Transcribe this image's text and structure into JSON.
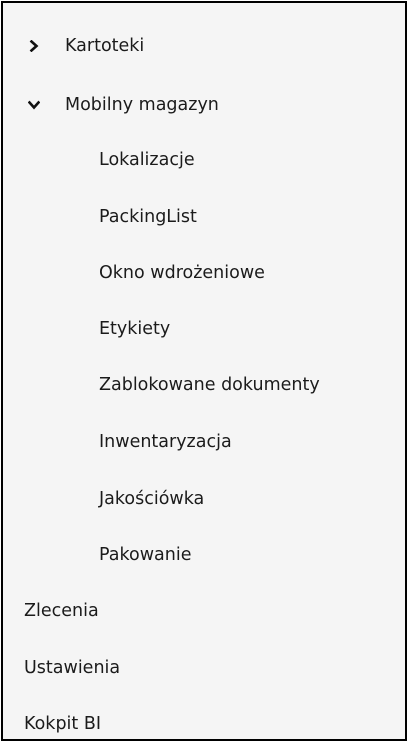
{
  "menu": {
    "kartoteki": {
      "label": "Kartoteki",
      "icon": "chevron-right-icon"
    },
    "mobilny_magazyn": {
      "label": "Mobilny magazyn",
      "icon": "chevron-down-icon",
      "children": [
        "Lokalizacje",
        "PackingList",
        "Okno wdrożeniowe",
        "Etykiety",
        "Zablokowane dokumenty",
        "Inwentaryzacja",
        "Jakościówka",
        "Pakowanie"
      ]
    },
    "zlecenia": {
      "label": "Zlecenia"
    },
    "ustawienia": {
      "label": "Ustawienia"
    },
    "kokpit_bi": {
      "label": "Kokpit BI"
    }
  }
}
